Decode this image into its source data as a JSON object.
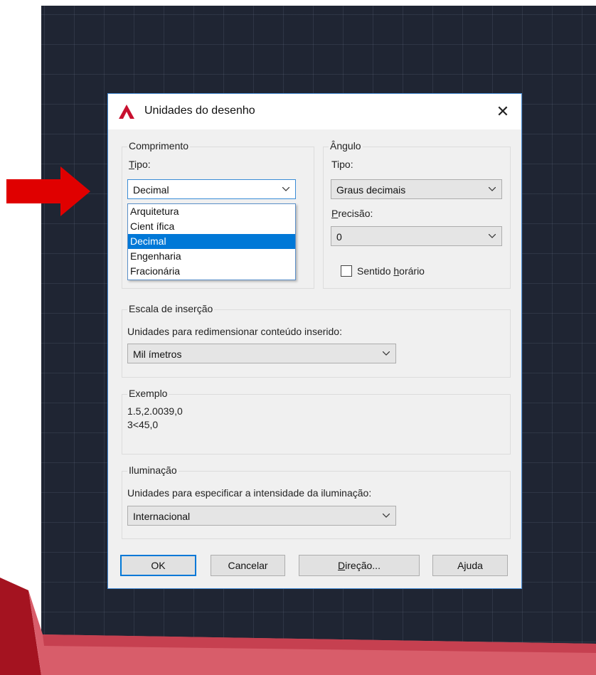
{
  "dialog": {
    "title": "Unidades do desenho",
    "close": "✕"
  },
  "length": {
    "group_label": "Comprimento",
    "type_label": "Tipo:",
    "type_value": "Decimal",
    "options": [
      "Arquitetura",
      "Cient ífica",
      "Decimal",
      "Engenharia",
      "Fracionária"
    ],
    "selected_index": 2
  },
  "angle": {
    "group_label": "Ângulo",
    "type_label": "Tipo:",
    "type_value": "Graus decimais",
    "precision_label": "Precisão:",
    "precision_value": "0",
    "clockwise_label": "Sentido horário",
    "clockwise_checked": false
  },
  "insertion": {
    "group_label": "Escala de inserção",
    "units_label": "Unidades para redimensionar conteúdo inserido:",
    "units_value": "Mil ímetros"
  },
  "example": {
    "group_label": "Exemplo",
    "line1": "1.5,2.0039,0",
    "line2": "3<45,0"
  },
  "lighting": {
    "group_label": "Iluminação",
    "units_label": "Unidades para especificar a intensidade da iluminação:",
    "units_value": "Internacional"
  },
  "buttons": {
    "ok": "OK",
    "cancel": "Cancelar",
    "direction": "Direção...",
    "help": "Ajuda"
  },
  "colors": {
    "accent": "#0078d7",
    "arrow": "#e00000",
    "logo": "#c8102e"
  }
}
